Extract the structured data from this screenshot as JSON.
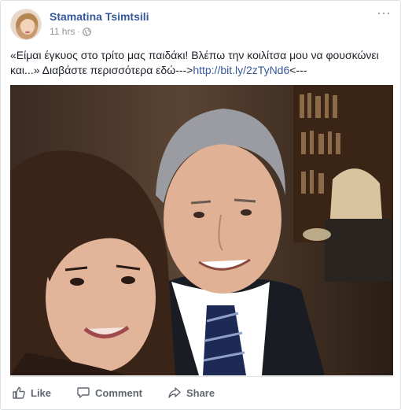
{
  "post": {
    "author": "Stamatina Tsimtsili",
    "time": "11 hrs",
    "separator": "·",
    "text_main": "«Είμαι έγκυος στο τρίτο μας παιδάκι! Βλέπω την κοιλίτσα μου να φουσκώνει και...» Διαβάστε περισσότερα εδώ--->",
    "link": "http://bit.ly/2zTyNd6",
    "text_tail": "<---",
    "more_glyph": "···"
  },
  "actions": {
    "like": "Like",
    "comment": "Comment",
    "share": "Share"
  },
  "icons": {
    "avatar": "avatar-photo",
    "privacy": "globe-icon",
    "more": "more-options-icon",
    "like": "thumbs-up-icon",
    "comment": "comment-bubble-icon",
    "share": "share-arrow-icon"
  },
  "colors": {
    "author": "#365899",
    "link": "#365899",
    "meta": "#90949c",
    "action": "#616770"
  }
}
